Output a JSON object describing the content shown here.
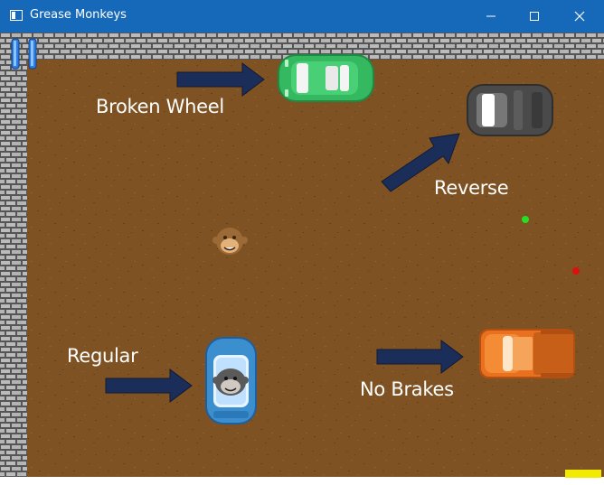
{
  "window": {
    "title": "Grease Monkeys",
    "controls": {
      "minimize": "−",
      "maximize": "□",
      "close": "✕"
    },
    "titlebar_color": "#1669b8"
  },
  "game": {
    "colors": {
      "dirt": "#7f5223",
      "brick": "#b7b7b7",
      "mortar": "#555555",
      "arrow": "#1b2d59",
      "label_text": "#ffffff",
      "indicator": "#f2ea00"
    },
    "labels": {
      "broken_wheel": "Broken Wheel",
      "reverse": "Reverse",
      "regular": "Regular",
      "no_brakes": "No Brakes"
    },
    "cars": [
      {
        "name": "green-car",
        "type": "Broken Wheel",
        "color": "#2fae5a"
      },
      {
        "name": "gray-car",
        "type": "Reverse",
        "color": "#4a4a4a"
      },
      {
        "name": "blue-car",
        "type": "Regular",
        "color": "#3b8fcf",
        "driver": "monkey-icon"
      },
      {
        "name": "orange-car",
        "type": "No Brakes",
        "color": "#e86a1c"
      }
    ],
    "markers": [
      {
        "name": "green-dot",
        "color": "#22e022"
      },
      {
        "name": "red-dot",
        "color": "#dd1010"
      }
    ],
    "icons": [
      "pause-icon",
      "monkey-icon"
    ]
  }
}
